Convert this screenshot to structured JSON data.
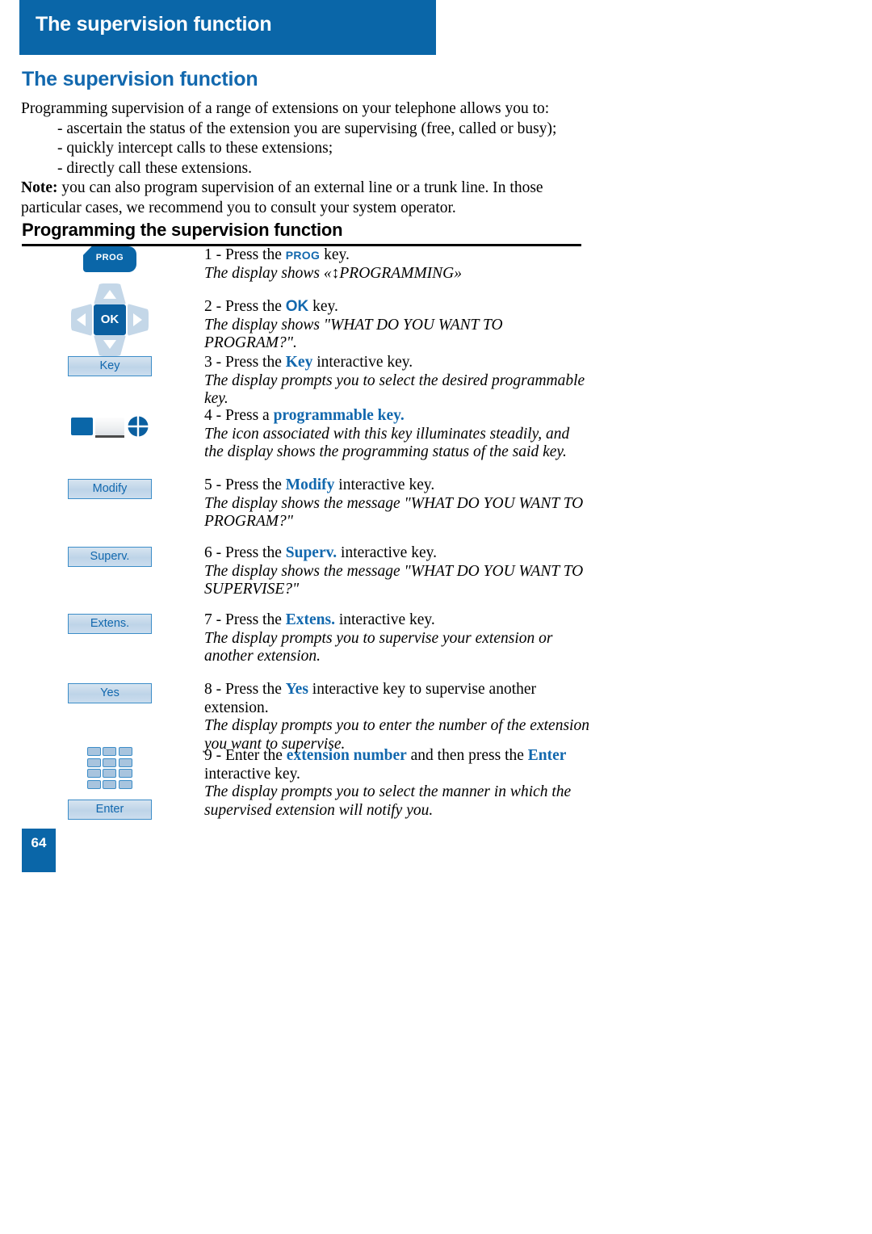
{
  "header": {
    "bar_title": "The supervision function",
    "page_title": "The supervision function",
    "bar_color": "#0A66A8",
    "title_color": "#1268AE"
  },
  "intro": {
    "lead": "Programming supervision of a range of extensions on your telephone allows you to:",
    "bullets": [
      "- ascertain the status of the extension you are supervising (free, called or busy);",
      "- quickly intercept calls to these extensions;",
      "- directly call these extensions."
    ],
    "note_label": "Note:",
    "note_text": " you can also program supervision of an external line or a trunk line. In those particular cases, we recommend you to consult your system operator."
  },
  "section": {
    "heading": "Programming the supervision function"
  },
  "steps": [
    {
      "id": "step-1",
      "visual": "prog-hardware-key",
      "visual_label": "PROG",
      "num": "1 - Press the ",
      "kw": "PROG",
      "after": " key.",
      "desc": "The display shows «↕PROGRAMMING»"
    },
    {
      "id": "step-2",
      "visual": "navigator-ok-pad",
      "visual_label": "OK",
      "num": "2 - Press the ",
      "kw": "OK",
      "after": " key.",
      "desc": "The display shows \"WHAT DO YOU WANT TO PROGRAM?\"."
    },
    {
      "id": "step-3",
      "visual": "softkey",
      "visual_label": "Key",
      "num": "3 - Press the ",
      "kw": "Key",
      "after": " interactive key.",
      "desc": "The display prompts you to select the desired programmable key."
    },
    {
      "id": "step-4",
      "visual": "programmable-key-icon",
      "visual_label": "",
      "num": "4 - Press a ",
      "kw": "programmable key.",
      "after": "",
      "desc": "The icon associated with this key illuminates steadily, and the display shows the programming status of the said key."
    },
    {
      "id": "step-5",
      "visual": "softkey",
      "visual_label": "Modify",
      "num": "5 - Press the ",
      "kw": "Modify",
      "after": " interactive key.",
      "desc": "The display shows the message \"WHAT DO YOU WANT TO PROGRAM?\""
    },
    {
      "id": "step-6",
      "visual": "softkey",
      "visual_label": "Superv.",
      "num": "6 - Press the ",
      "kw": "Superv.",
      "after": " interactive key.",
      "desc": "The display shows the message \"WHAT DO YOU WANT TO SUPERVISE?\""
    },
    {
      "id": "step-7",
      "visual": "softkey",
      "visual_label": "Extens.",
      "num": "7 - Press the ",
      "kw": "Extens.",
      "after": " interactive key.",
      "desc": "The display prompts you to supervise your extension or another extension."
    },
    {
      "id": "step-8",
      "visual": "softkey",
      "visual_label": "Yes",
      "num": "8 - Press the ",
      "kw": "Yes",
      "after": " interactive key to supervise another extension.",
      "desc": "The display prompts you to enter the number of the extension you want to supervise."
    },
    {
      "id": "step-9",
      "visual": "keypad-and-softkey",
      "visual_label": "Enter",
      "num": "9 - Enter the ",
      "kw": "extension number",
      "after": " and then press the ",
      "kw2": "Enter",
      "after2": " interactive key.",
      "desc": "The display prompts you to select the manner in which the supervised extension will notify you."
    }
  ],
  "footer": {
    "page_number": "64"
  }
}
